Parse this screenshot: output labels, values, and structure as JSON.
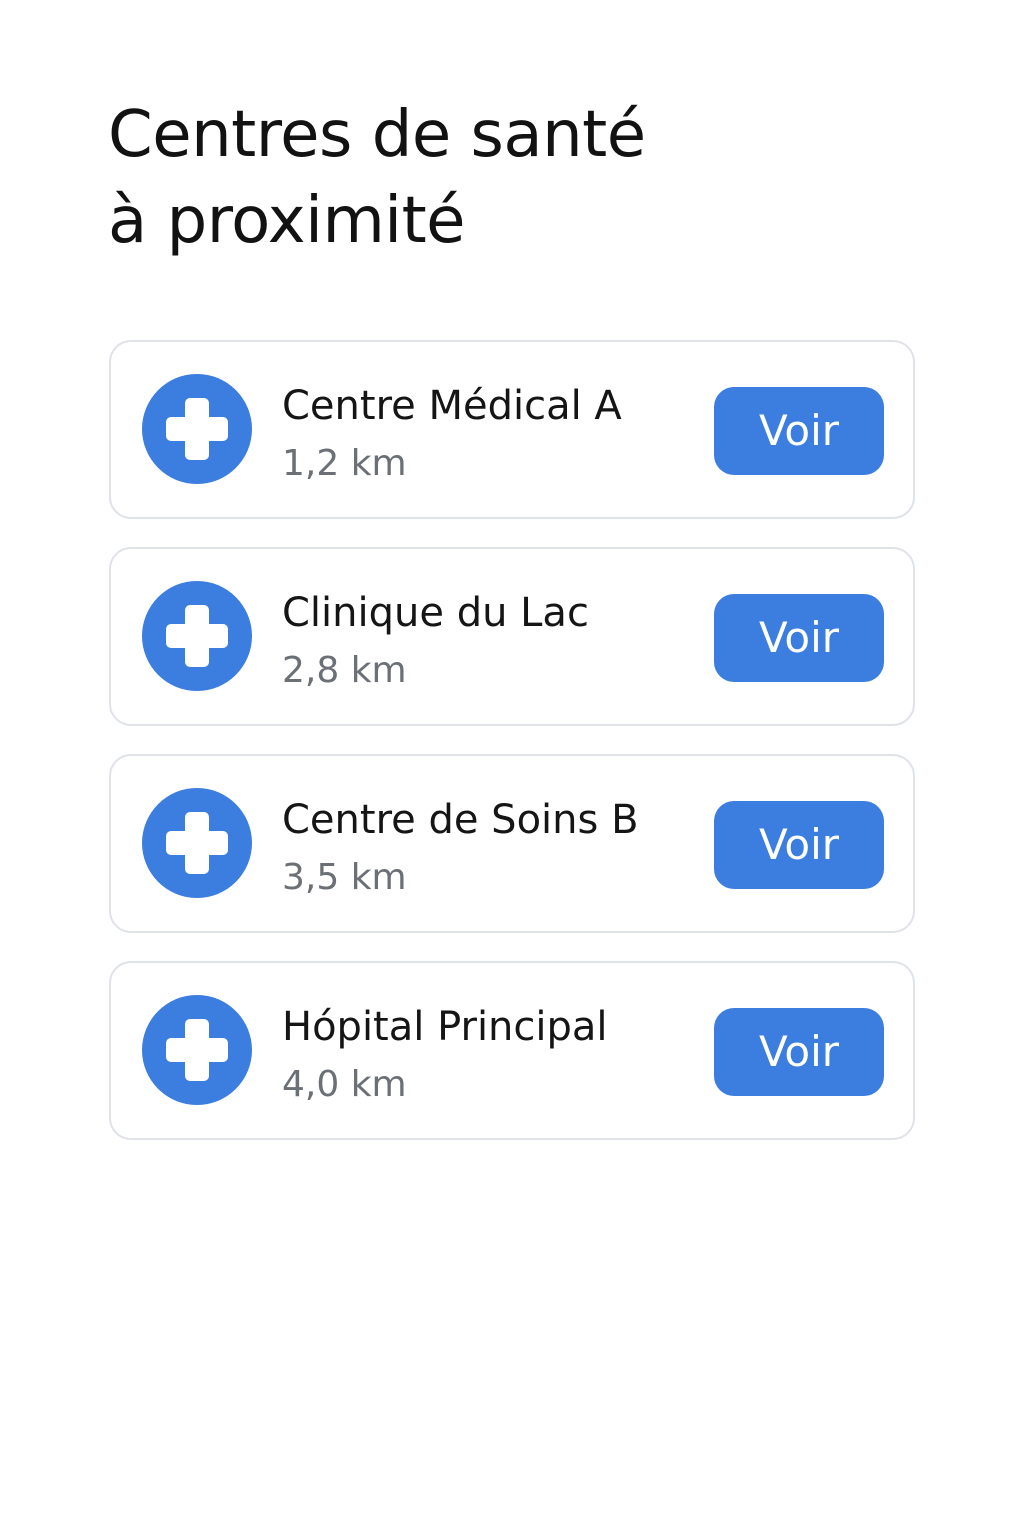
{
  "header": {
    "title_line1": "Centres de santé",
    "title_line2": "à proximité"
  },
  "colors": {
    "accent": "#3B7EE0",
    "card_border": "#DFE3E8",
    "secondary_text": "#6B6F76"
  },
  "centers": [
    {
      "name": "Centre Médical A",
      "distance": "1,2 km",
      "icon": "medical-cross-icon",
      "action_label": "Voir"
    },
    {
      "name": "Clinique du Lac",
      "distance": "2,8 km",
      "icon": "medical-cross-icon",
      "action_label": "Voir"
    },
    {
      "name": "Centre de Soins B",
      "distance": "3,5 km",
      "icon": "medical-cross-icon",
      "action_label": "Voir"
    },
    {
      "name": "Hópital Principal",
      "distance": "4,0 km",
      "icon": "medical-cross-icon",
      "action_label": "Voir"
    }
  ]
}
